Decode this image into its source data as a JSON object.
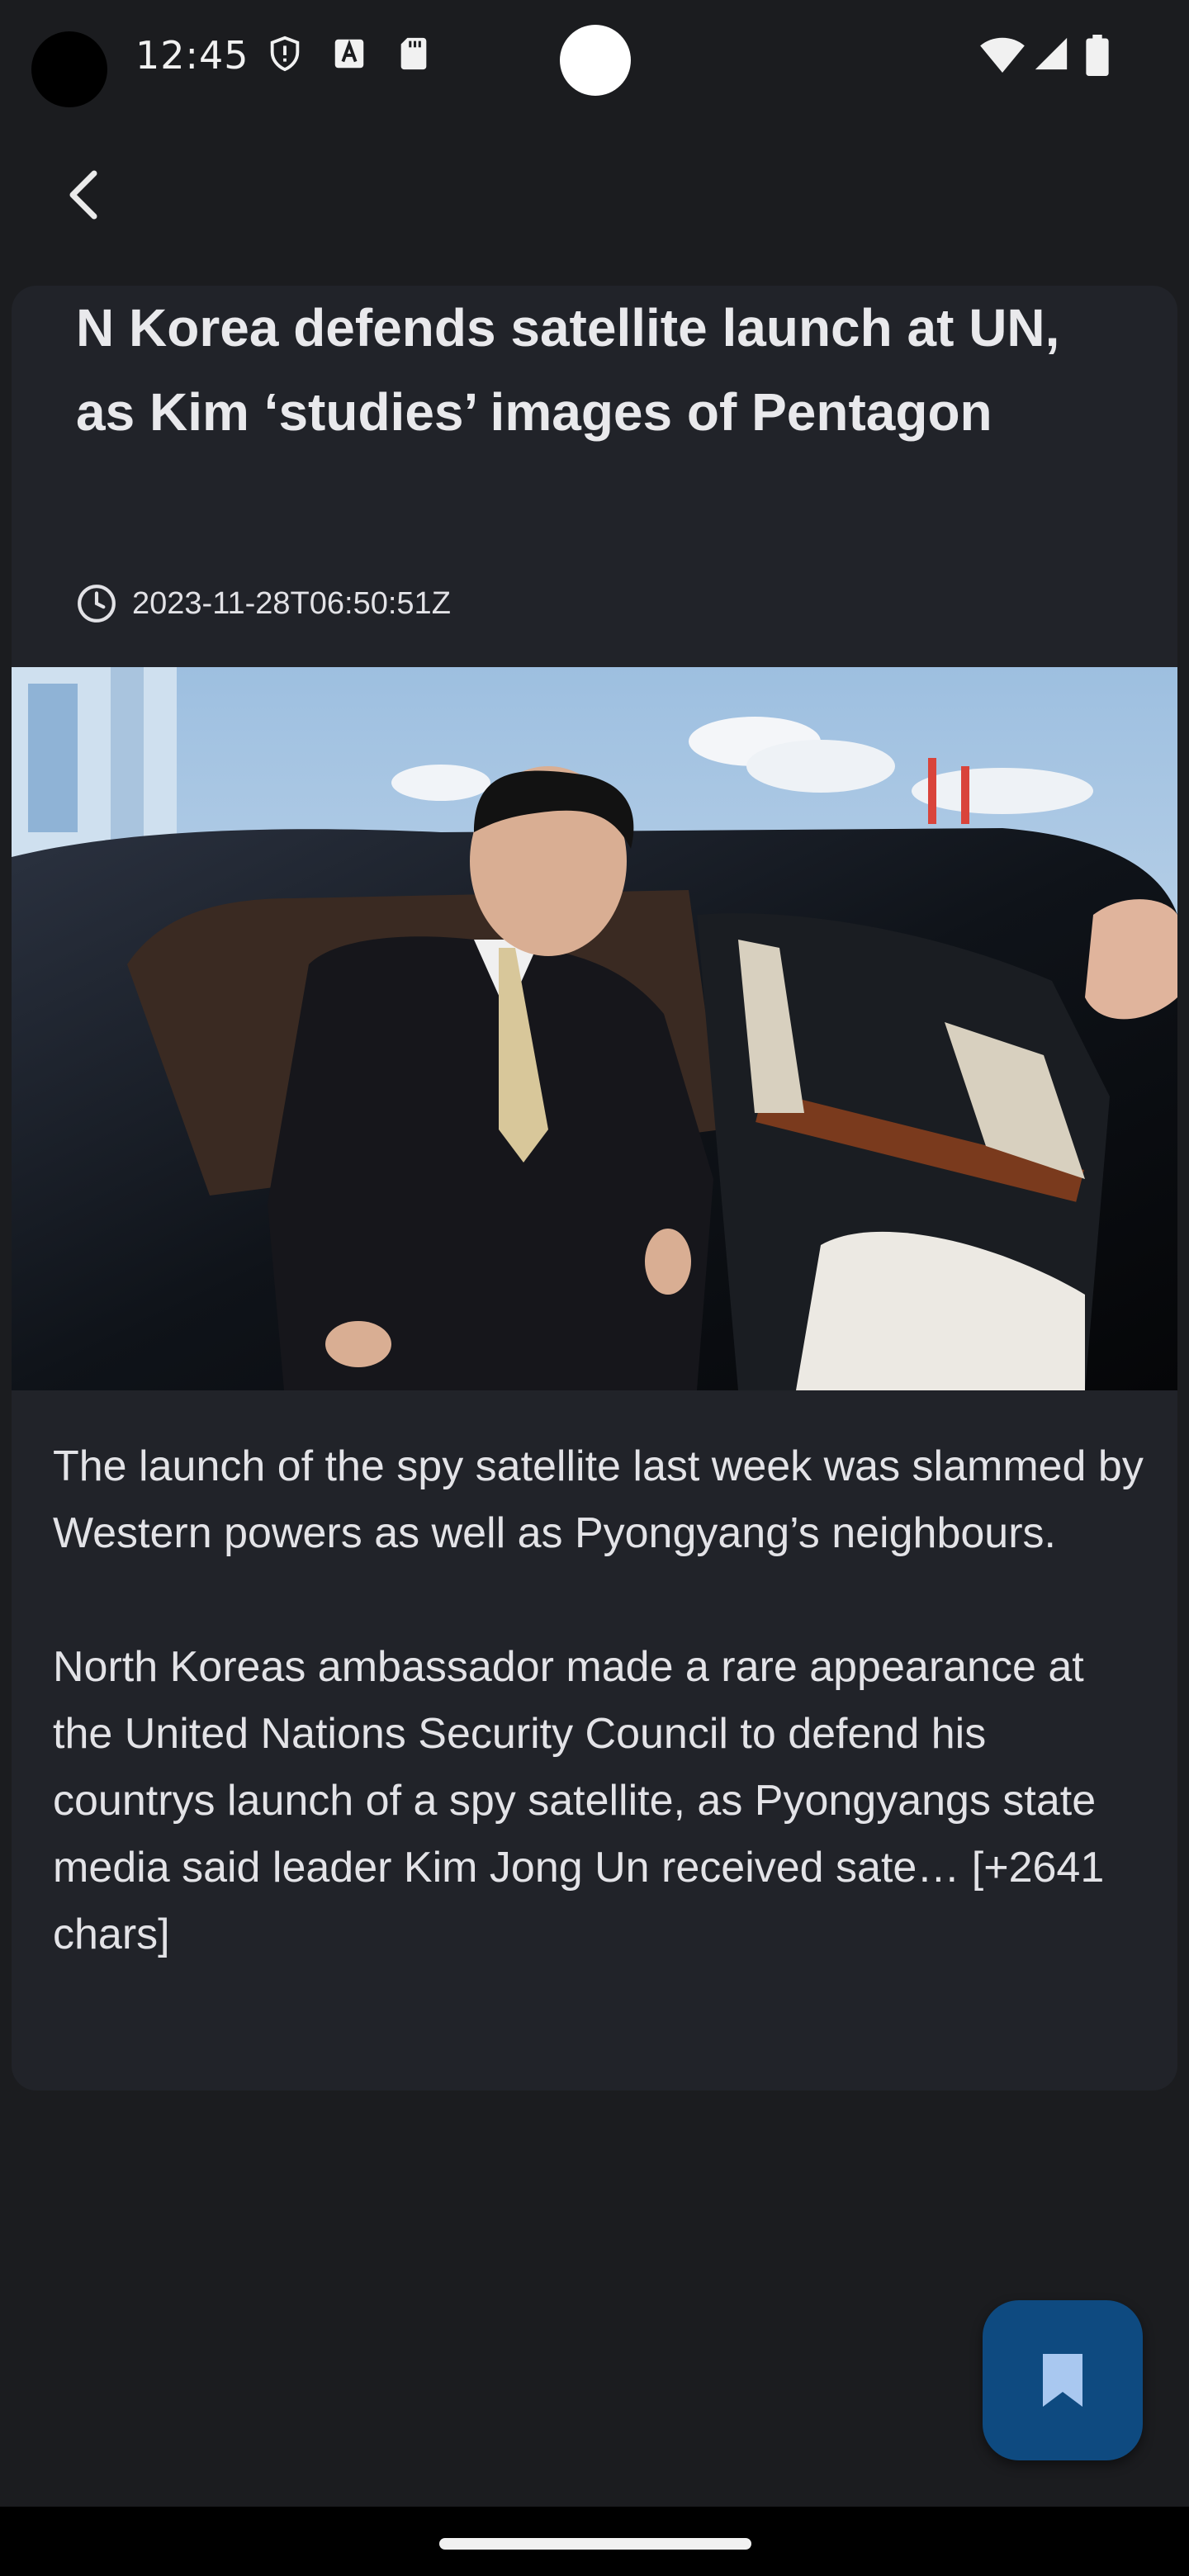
{
  "status_bar": {
    "time": "12:45",
    "left_icons": [
      "shield-icon",
      "a-badge-icon",
      "sd-card-icon"
    ],
    "right_icons": [
      "wifi-icon",
      "signal-icon",
      "battery-icon"
    ]
  },
  "toolbar": {
    "back_icon": "chevron-left-icon"
  },
  "article": {
    "title": "N Korea defends satellite launch at UN, as Kim ‘studies’ images of Pentagon",
    "time_icon": "clock-icon",
    "published": "2023-11-28T06:50:51Z",
    "image_alt": "Kim Jong Un stepping out of a black limousine",
    "paragraphs": [
      "The launch of the spy satellite last week was slammed by Western powers as well as Pyongyang’s neighbours.",
      "North Koreas ambassador made a rare appearance at the United Nations Security Council to defend his countrys launch of a spy satellite, as Pyongyangs state media said leader Kim Jong Un received sate… [+2641 chars]"
    ]
  },
  "fab": {
    "icon": "bookmark-icon",
    "color": "#0e4a80"
  },
  "colors": {
    "background": "#1b1c1f",
    "card": "#212329",
    "text": "#e6e6e9"
  }
}
